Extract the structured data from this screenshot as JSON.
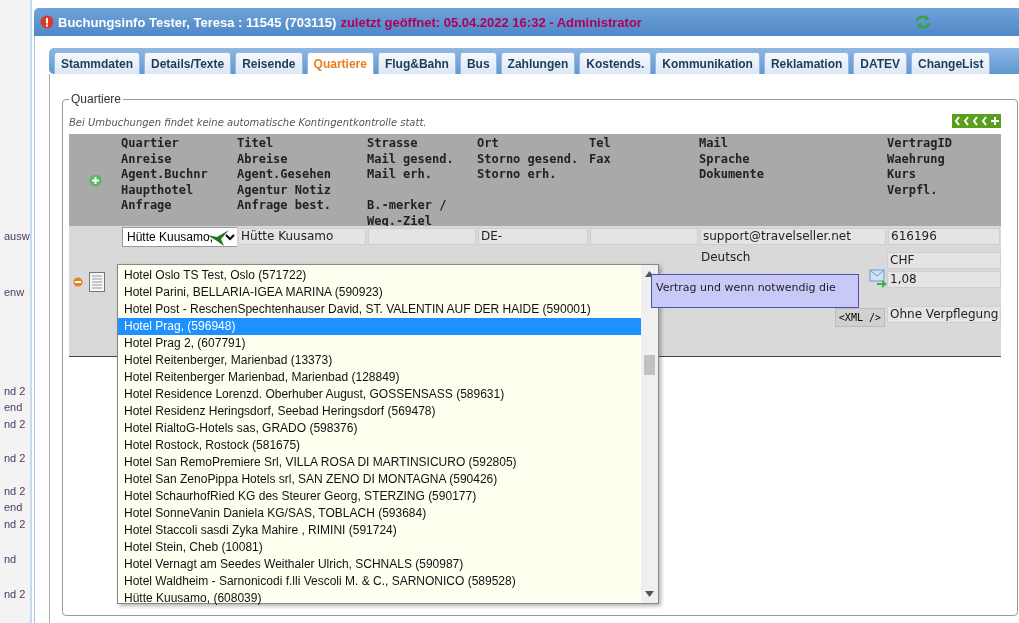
{
  "left_edge": {
    "fragments": [
      "ausw",
      "enw",
      "nd 2",
      "end",
      "nd 2",
      "nd 2",
      "nd 2",
      "end",
      "nd 2",
      "nd",
      "nd 2"
    ]
  },
  "window": {
    "title": "Buchungsinfo Tester, Teresa : 11545 (703115)",
    "subtitle": "zuletzt geöffnet: 05.04.2022 16:32 - Administrator"
  },
  "tabs": [
    {
      "label": "Stammdaten",
      "selected": false
    },
    {
      "label": "Details/Texte",
      "selected": false
    },
    {
      "label": "Reisende",
      "selected": false
    },
    {
      "label": "Quartiere",
      "selected": true
    },
    {
      "label": "Flug&Bahn",
      "selected": false
    },
    {
      "label": "Bus",
      "selected": false
    },
    {
      "label": "Zahlungen",
      "selected": false
    },
    {
      "label": "Kostends.",
      "selected": false
    },
    {
      "label": "Kommunikation",
      "selected": false
    },
    {
      "label": "Reklamation",
      "selected": false
    },
    {
      "label": "DATEV",
      "selected": false
    },
    {
      "label": "ChangeList",
      "selected": false
    }
  ],
  "section": {
    "legend": "Quartiere",
    "note": "Bei Umbuchungen findet keine automatische Kontingentkontrolle statt."
  },
  "table": {
    "columns": [
      {
        "lines": [
          "Quartier",
          "Anreise",
          "Agent.Buchnr",
          "Haupthotel",
          "Anfrage"
        ]
      },
      {
        "lines": [
          "Titel",
          "Abreise",
          "Agent.Gesehen",
          "Agentur Notiz",
          "Anfrage best."
        ]
      },
      {
        "lines": [
          "Strasse",
          "Mail gesend.",
          "Mail erh."
        ],
        "lower_lines": [
          "B.-merker /",
          "Weg.-Ziel"
        ]
      },
      {
        "lines": [
          "Ort",
          "Storno gesend.",
          "Storno erh."
        ]
      },
      {
        "lines": [
          "Tel",
          "Fax"
        ]
      },
      {
        "lines": [
          "Mail",
          "Sprache",
          "Dokumente"
        ]
      },
      {
        "lines": [
          "VertragID",
          "Waehrung",
          "Kurs",
          "Verpfl."
        ]
      }
    ],
    "first_row": [
      {
        "kind": "select",
        "text": "Hütte Kuusamo,"
      },
      {
        "kind": "field",
        "text": "Hütte Kuusamo"
      },
      {
        "kind": "field"
      },
      {
        "kind": "field",
        "text": "DE-"
      },
      {
        "kind": "field"
      },
      {
        "kind": "field",
        "text": "support@travelseller.net"
      },
      {
        "kind": "field",
        "text": "616196"
      }
    ],
    "language": "Deutsch",
    "currency": "CHF",
    "rate": "1,08",
    "xml_button": "<XML />",
    "board": "Ohne Verpflegung"
  },
  "tooltip": "Vertrag und wenn notwendig die",
  "dropdown": {
    "options": [
      {
        "label": "Hotel Oslo TS Test, Oslo (571722)",
        "selected": false
      },
      {
        "label": "Hotel Parini, BELLARIA-IGEA MARINA (590923)",
        "selected": false
      },
      {
        "label": "Hotel Post - ReschenSpechtenhauser David, ST. VALENTIN AUF DER HAIDE (590001)",
        "selected": false
      },
      {
        "label": "Hotel Prag, (596948)",
        "selected": true
      },
      {
        "label": "Hotel Prag 2, (607791)",
        "selected": false
      },
      {
        "label": "Hotel Reitenberger, Marienbad (13373)",
        "selected": false
      },
      {
        "label": "Hotel Reitenberger Marienbad, Marienbad (128849)",
        "selected": false
      },
      {
        "label": "Hotel Residence Lorenzd. Oberhuber August, GOSSENSASS (589631)",
        "selected": false
      },
      {
        "label": "Hotel Residenz Heringsdorf, Seebad Heringsdorf (569478)",
        "selected": false
      },
      {
        "label": "Hotel RialtoG-Hotels sas, GRADO (598376)",
        "selected": false
      },
      {
        "label": "Hotel Rostock, Rostock (581675)",
        "selected": false
      },
      {
        "label": "Hotel San RemoPremiere Srl, VILLA ROSA DI MARTINSICURO (592805)",
        "selected": false
      },
      {
        "label": "Hotel San ZenoPippa Hotels srl, SAN ZENO DI MONTAGNA (590426)",
        "selected": false
      },
      {
        "label": "Hotel SchaurhofRied KG des Steurer Georg, STERZING (590177)",
        "selected": false
      },
      {
        "label": "Hotel SonneVanin Daniela KG/SAS, TOBLACH (593684)",
        "selected": false
      },
      {
        "label": "Hotel Staccoli sasdi Zyka Mahire , RIMINI (591724)",
        "selected": false
      },
      {
        "label": "Hotel Stein, Cheb (10081)",
        "selected": false
      },
      {
        "label": "Hotel Vernagt am Seedes Weithaler Ulrich, SCHNALS (590987)",
        "selected": false
      },
      {
        "label": "Hotel Waldheim - Sarnonicodi f.lli Vescoli M. & C., SARNONICO (589528)",
        "selected": false
      },
      {
        "label": "Hütte Kuusamo, (608039)",
        "selected": false
      }
    ]
  }
}
